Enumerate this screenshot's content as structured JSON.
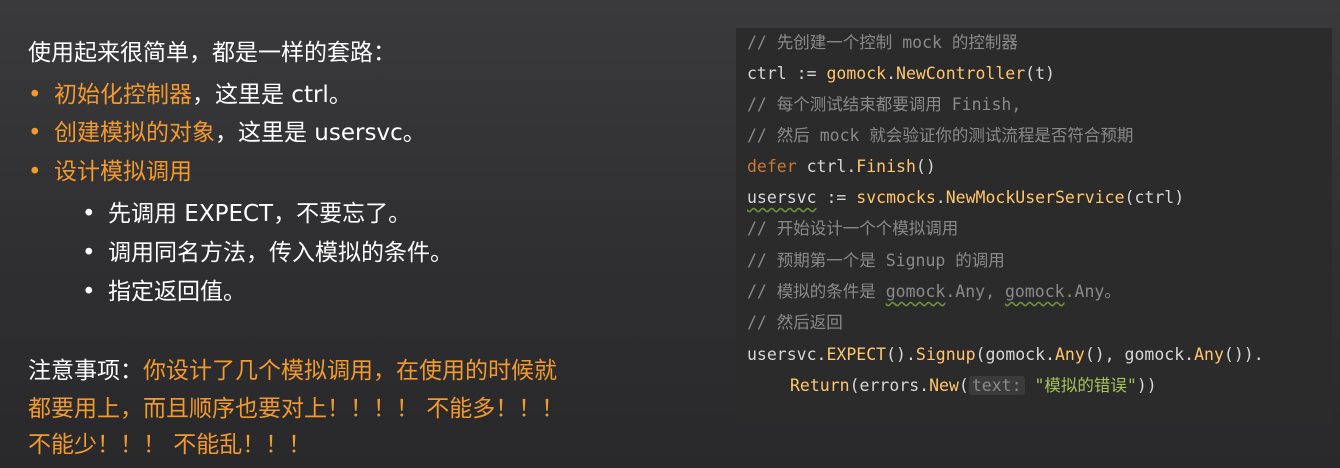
{
  "left": {
    "intro": "使用起来很简单，都是一样的套路：",
    "steps": [
      {
        "highlight": "初始化控制器",
        "rest": "，这里是 ctrl。"
      },
      {
        "highlight": "创建模拟的对象",
        "rest": "，这里是 usersvc。"
      },
      {
        "highlight": "设计模拟调用",
        "rest": ""
      }
    ],
    "substeps": [
      "先调用 EXPECT，不要忘了。",
      "调用同名方法，传入模拟的条件。",
      "指定返回值。"
    ],
    "bullet": "•",
    "note": {
      "label": "注意事项：",
      "line1": "你设计了几个模拟调用，在使用的时候就",
      "line2": "都要用上，而且顺序也要对上！！！！ 不能多！！！",
      "line3": "不能少！！！ 不能乱！！！"
    }
  },
  "code": {
    "l1": "// 先创建一个控制 mock 的控制器",
    "l2": {
      "a": "ctrl := ",
      "b": "gomock",
      "c": ".",
      "d": "NewController",
      "e": "(t)"
    },
    "l3": "// 每个测试结束都要调用 Finish,",
    "l4": "// 然后 mock 就会验证你的测试流程是否符合预期",
    "l5": {
      "a": "defer",
      "b": " ctrl.",
      "c": "Finish",
      "d": "()"
    },
    "l6": {
      "a": "usersvc",
      "b": " := ",
      "c": "svcmocks",
      "d": ".",
      "e": "NewMockUserService",
      "f": "(ctrl)"
    },
    "l7": "// 开始设计一个个模拟调用",
    "l8": "// 预期第一个是 Signup 的调用",
    "l9": {
      "a": "// 模拟的条件是 ",
      "b": "gomock",
      "c": ".Any, ",
      "d": "gomock",
      "e": ".Any。"
    },
    "l10": "// 然后返回",
    "l11": {
      "a": "usersvc.",
      "b": "EXPECT",
      "c": "().",
      "d": "Signup",
      "e": "(gomock.",
      "f": "Any",
      "g": "(), gomock.",
      "h": "Any",
      "i": "())."
    },
    "l12": {
      "a": "Return",
      "b": "(errors.",
      "c": "New",
      "d": "(",
      "hint": "text:",
      "e": " ",
      "str": "\"模拟的错误\"",
      "f": "))"
    }
  }
}
